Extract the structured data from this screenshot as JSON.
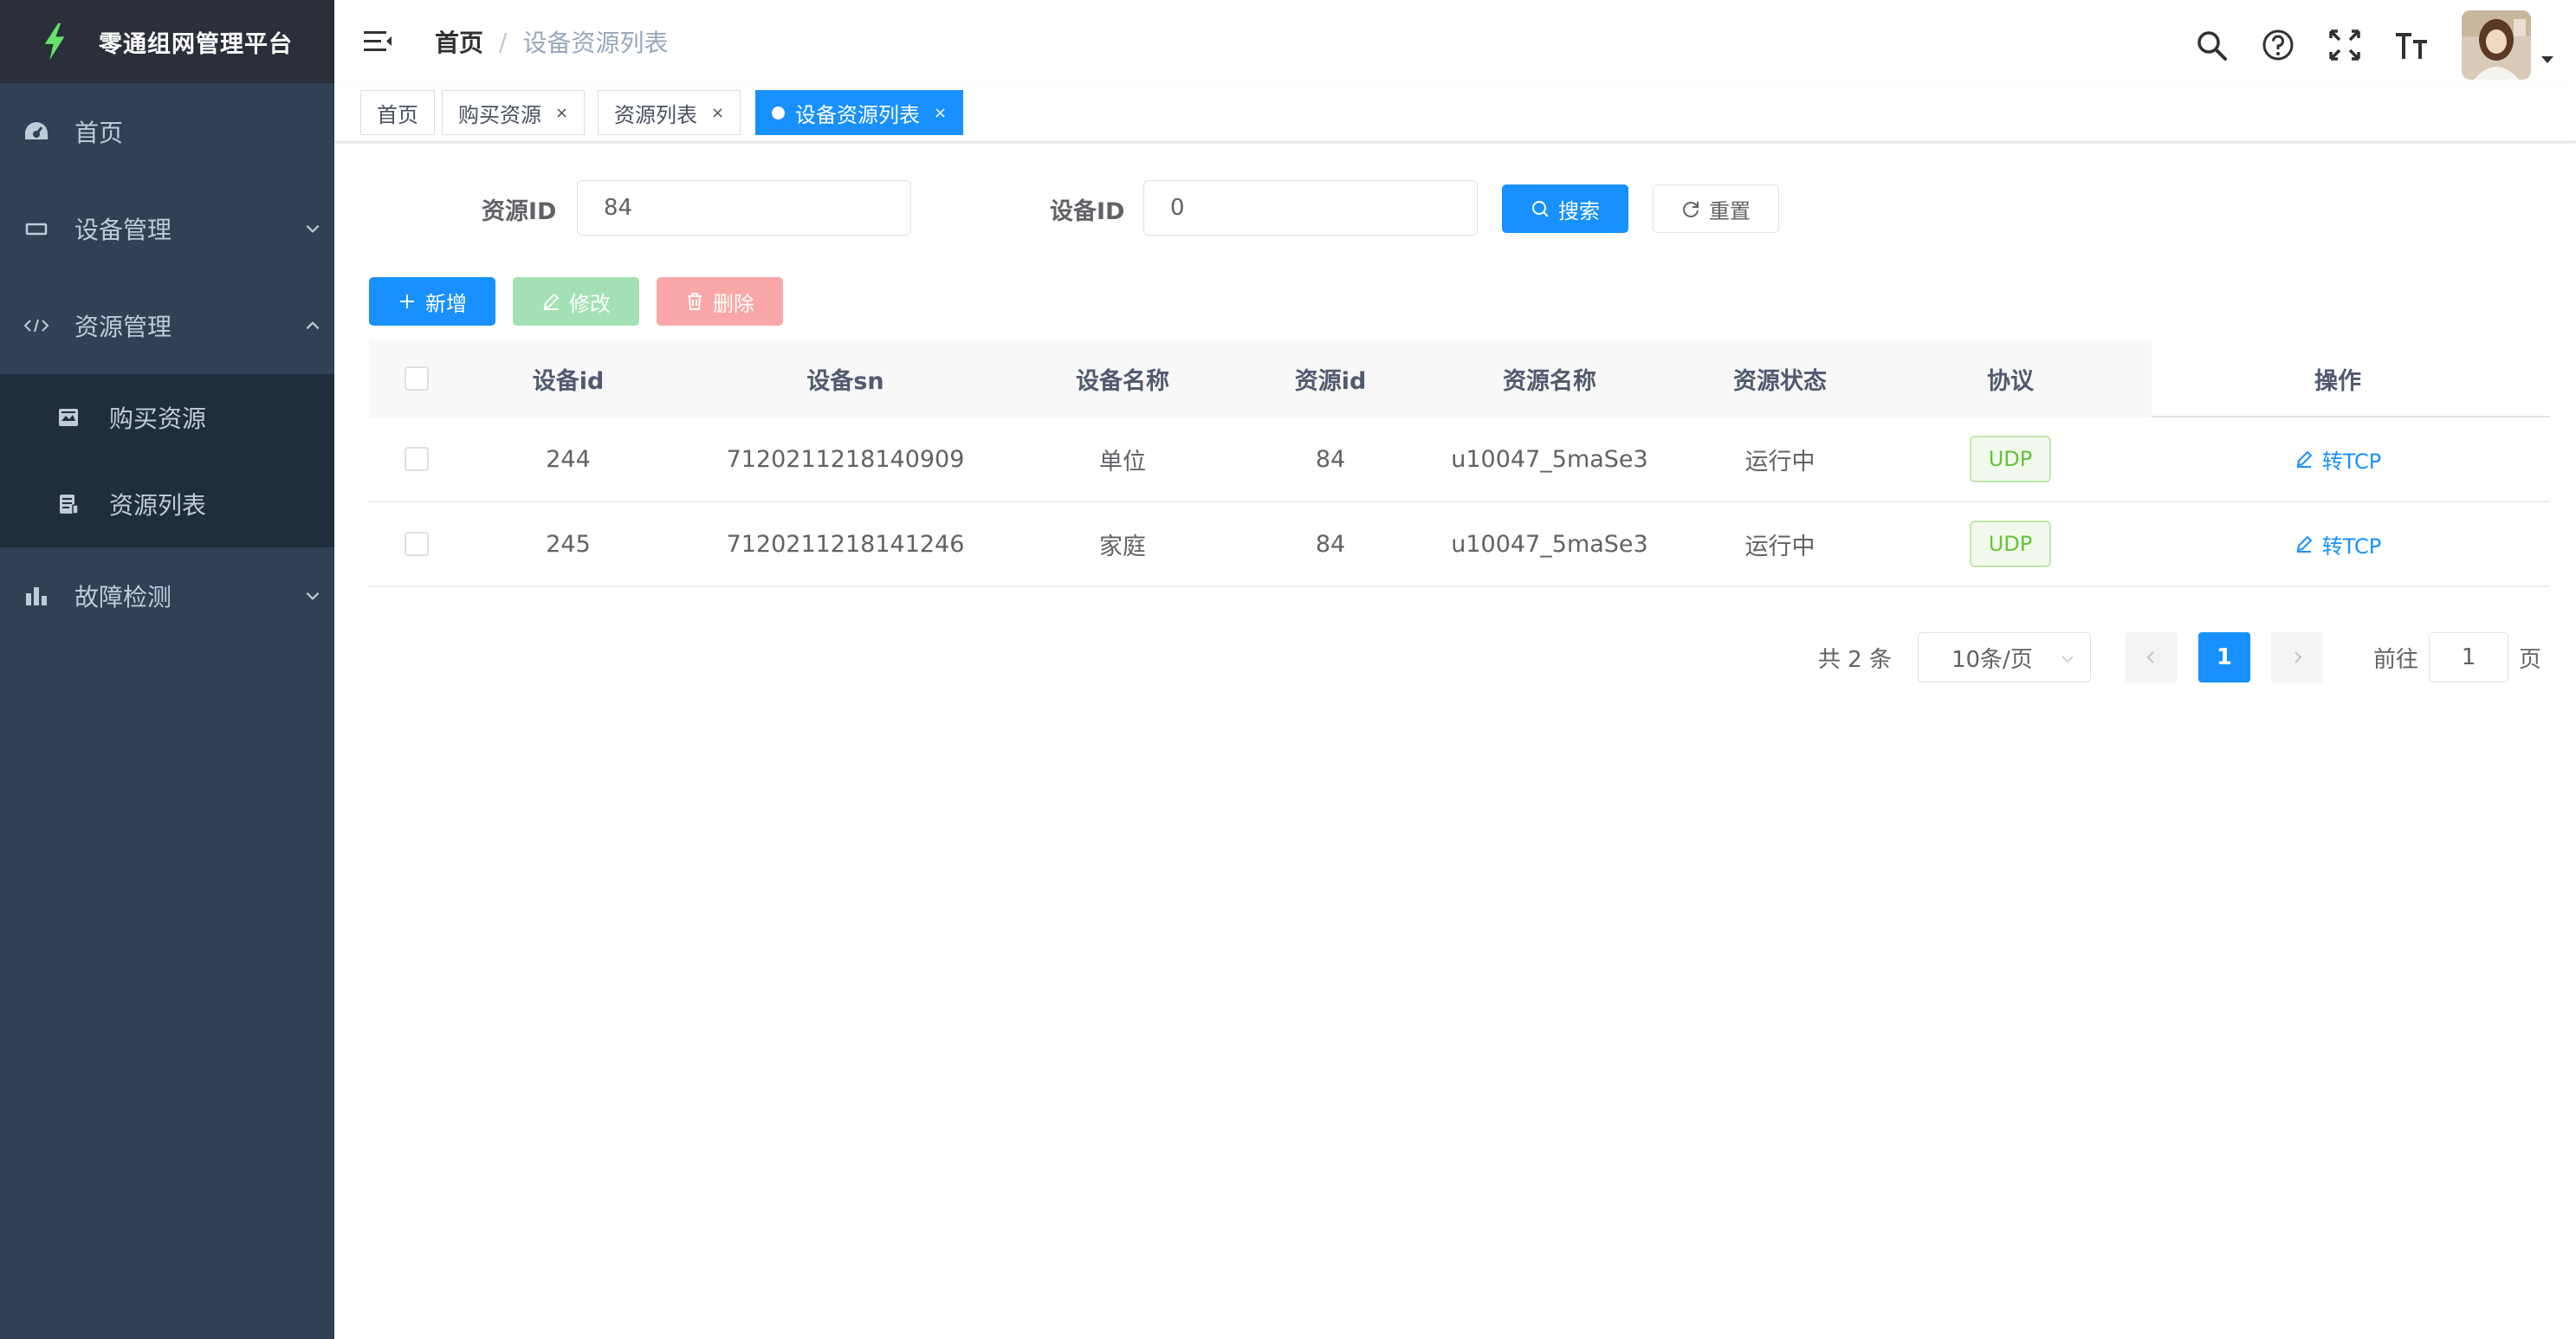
{
  "app": {
    "title": "零通组网管理平台"
  },
  "sidebar": {
    "items": [
      {
        "label": "首页",
        "icon": "dashboard-icon"
      },
      {
        "label": "设备管理",
        "icon": "device-icon",
        "expanded": false
      },
      {
        "label": "资源管理",
        "icon": "code-icon",
        "expanded": true,
        "children": [
          {
            "label": "购买资源",
            "icon": "purchase-icon"
          },
          {
            "label": "资源列表",
            "icon": "list-icon"
          }
        ]
      },
      {
        "label": "故障检测",
        "icon": "bar-chart-icon",
        "expanded": false
      }
    ]
  },
  "navbar": {
    "breadcrumb": {
      "home": "首页",
      "separator": "/",
      "current": "设备资源列表"
    },
    "icons": [
      "search-icon",
      "help-icon",
      "fullscreen-icon",
      "font-size-icon"
    ]
  },
  "tags": [
    {
      "label": "首页",
      "closable": false,
      "active": false
    },
    {
      "label": "购买资源",
      "closable": true,
      "active": false
    },
    {
      "label": "资源列表",
      "closable": true,
      "active": false
    },
    {
      "label": "设备资源列表",
      "closable": true,
      "active": true
    }
  ],
  "tag_close_glyph": "×",
  "search": {
    "resource_id_label": "资源ID",
    "resource_id_value": "84",
    "device_id_label": "设备ID",
    "device_id_value": "0",
    "search_label": "搜索",
    "reset_label": "重置"
  },
  "toolbar": {
    "add_label": "新增",
    "edit_label": "修改",
    "delete_label": "删除"
  },
  "table": {
    "columns": [
      "设备id",
      "设备sn",
      "设备名称",
      "资源id",
      "资源名称",
      "资源状态",
      "协议",
      "操作"
    ],
    "rows": [
      {
        "device_id": "244",
        "device_sn": "7120211218140909",
        "device_name": "单位",
        "resource_id": "84",
        "resource_name": "u10047_5maSe3",
        "status": "运行中",
        "protocol": "UDP",
        "action": "转TCP"
      },
      {
        "device_id": "245",
        "device_sn": "7120211218141246",
        "device_name": "家庭",
        "resource_id": "84",
        "resource_name": "u10047_5maSe3",
        "status": "运行中",
        "protocol": "UDP",
        "action": "转TCP"
      }
    ]
  },
  "pagination": {
    "total_text": "共 2 条",
    "page_size": "10条/页",
    "current_page": "1",
    "goto_prefix": "前往",
    "goto_value": "1",
    "goto_suffix": "页"
  },
  "colors": {
    "sidebar_bg": "#304156",
    "sidebar_submenu_bg": "#1f2d3d",
    "logo_bg": "#2b2f3a",
    "accent": "#1890ff",
    "success": "#67c23a",
    "logo_bolt": "#67e26a"
  }
}
